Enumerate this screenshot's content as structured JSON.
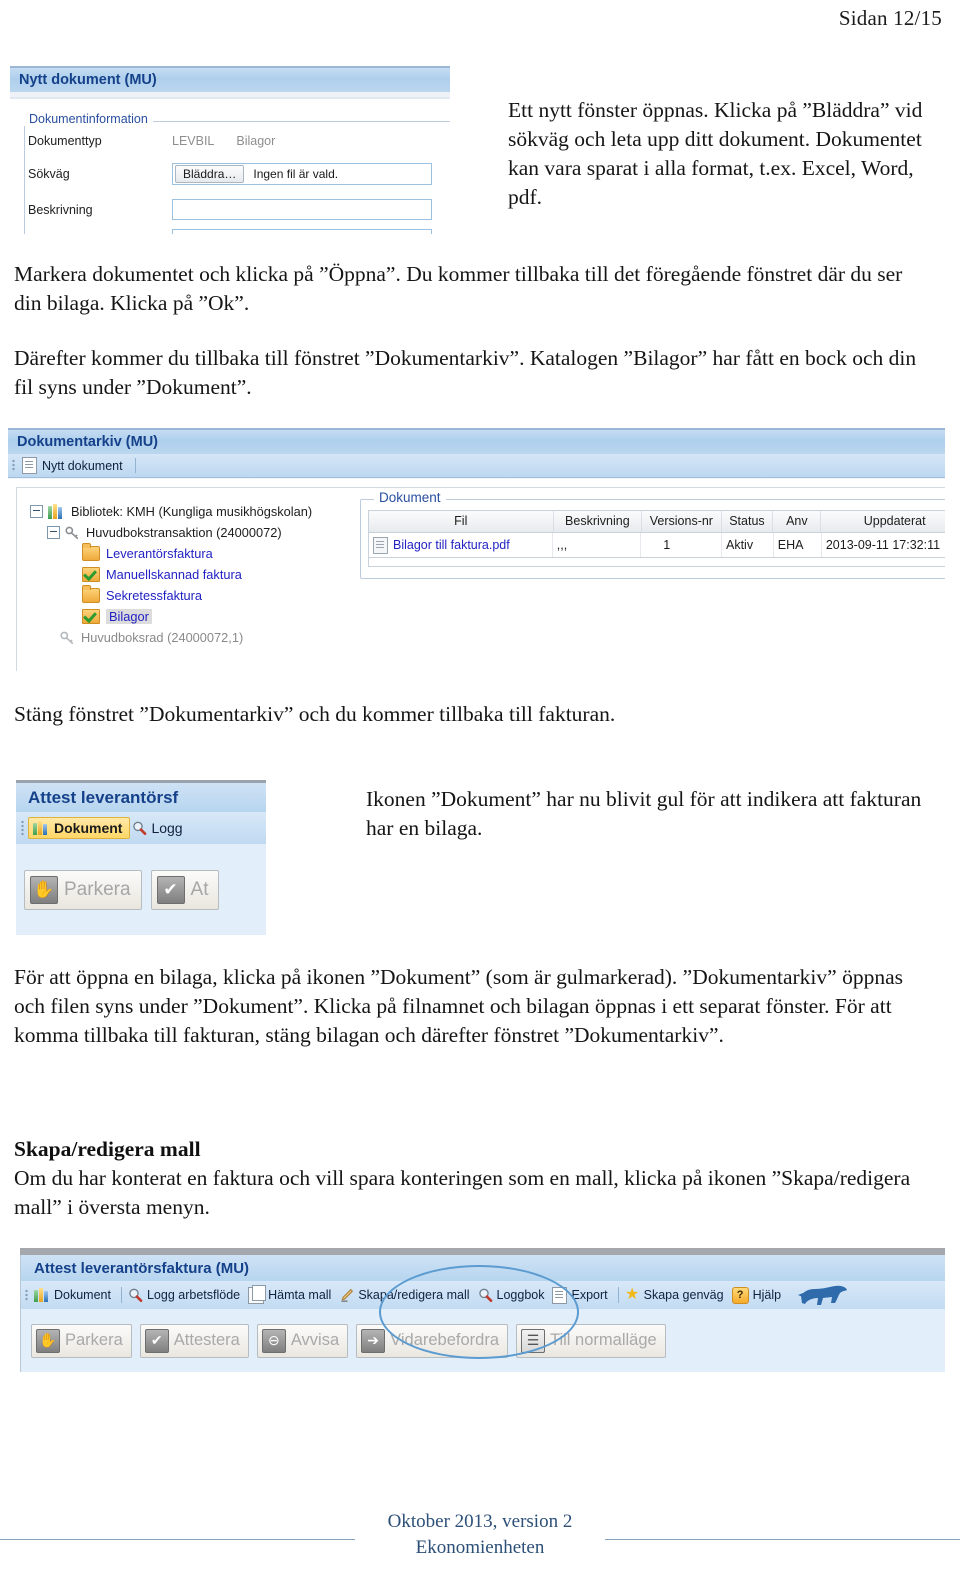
{
  "page": {
    "header": "Sidan 12/15"
  },
  "paragraphs": {
    "p_top_right": "Ett nytt fönster öppnas. Klicka på ”Bläddra” vid sökväg och leta upp ditt dokument. Dokumentet kan vara sparat i alla format, t.ex. Excel, Word, pdf.",
    "p_markera": "Markera dokumentet och klicka på ”Öppna”. Du kommer tillbaka till det föregående fönstret där du ser din bilaga. Klicka på ”Ok”.",
    "p_darefter": "Därefter kommer du tillbaka till fönstret ”Dokumentarkiv”. Katalogen ”Bilagor” har fått en bock och din fil syns under ”Dokument”.",
    "p_stang": "Stäng fönstret ”Dokumentarkiv” och du kommer tillbaka till fakturan.",
    "p_ikonen": "Ikonen ”Dokument” har nu blivit gul för att indikera att fakturan har en bilaga.",
    "p_foratt": "För att öppna en bilaga, klicka på ikonen ”Dokument” (som är gulmarkerad). ”Dokumentarkiv” öppnas och filen syns under ”Dokument”. Klicka på filnamnet och bilagan öppnas i ett separat fönster. För att komma tillbaka till fakturan, stäng bilagan och därefter fönstret ”Dokumentarkiv”.",
    "heading_skapa": "Skapa/redigera mall",
    "p_omdu": "Om du har konterat en faktura och vill spara konteringen som en mall, klicka på ikonen ”Skapa/redigera mall” i översta menyn."
  },
  "shot_nytt_dokument": {
    "title": "Nytt dokument (MU)",
    "group_legend": "Dokumentinformation",
    "rows": {
      "dokumenttyp_label": "Dokumenttyp",
      "dokumenttyp_value_1": "LEVBIL",
      "dokumenttyp_value_2": "Bilagor",
      "sokvag_label": "Sökväg",
      "browse_button": "Bläddra…",
      "browse_status": "Ingen fil är vald.",
      "beskrivning_label": "Beskrivning"
    }
  },
  "shot_dokumentarkiv": {
    "title": "Dokumentarkiv (MU)",
    "toolbar": {
      "new_document": "Nytt dokument"
    },
    "tree": [
      {
        "label": "Bibliotek: KMH (Kungliga musikhögskolan)",
        "icon": "books-icon",
        "style": "dark",
        "indent": 0,
        "expander": true
      },
      {
        "label": "Huvudbokstransaktion (24000072)",
        "icon": "key-icon",
        "style": "dark",
        "indent": 1,
        "expander": true
      },
      {
        "label": "Leverantörsfaktura",
        "icon": "folder-icon",
        "style": "link",
        "indent": 2,
        "expander": false
      },
      {
        "label": "Manuellskannad faktura",
        "icon": "folder-check-icon",
        "style": "link",
        "indent": 2,
        "expander": false
      },
      {
        "label": "Sekretessfaktura",
        "icon": "folder-icon",
        "style": "link",
        "indent": 2,
        "expander": false
      },
      {
        "label": "Bilagor",
        "icon": "folder-check-icon",
        "style": "selected",
        "indent": 2,
        "expander": false
      },
      {
        "label": "Huvudboksrad (24000072,1)",
        "icon": "key-icon",
        "style": "grey",
        "indent": 1,
        "expander": false
      }
    ],
    "document_group_legend": "Dokument",
    "grid": {
      "columns": [
        "Fil",
        "Beskrivning",
        "Versions-nr",
        "Status",
        "Anv",
        "Uppdaterat"
      ],
      "rows": [
        {
          "fil": "Bilagor till faktura.pdf",
          "beskrivning": ",,,",
          "versions_nr": "1",
          "status": "Aktiv",
          "anv": "EHA",
          "uppdaterat": "2013-09-11 17:32:11"
        }
      ]
    }
  },
  "shot_attest_crop": {
    "title": "Attest leverantörsf",
    "toolbar_items": [
      "Dokument",
      "Logg"
    ],
    "buttons": [
      "Parkera",
      "At"
    ]
  },
  "shot_bottom_toolbar": {
    "title": "Attest leverantörsfaktura (MU)",
    "toolbar_items": [
      {
        "label": "Dokument",
        "icon": "books-icon"
      },
      {
        "label": "Logg arbetsflöde",
        "icon": "magnifier-icon"
      },
      {
        "label": "Hämta mall",
        "icon": "copy-pages-icon"
      },
      {
        "label": "Skapa/redigera mall",
        "icon": "pencil-icon"
      },
      {
        "label": "Loggbok",
        "icon": "magnifier-icon"
      },
      {
        "label": "Export",
        "icon": "document-icon"
      },
      {
        "label": "Skapa genväg",
        "icon": "star-icon"
      },
      {
        "label": "Hjälp",
        "icon": "help-icon"
      }
    ],
    "action_buttons": [
      {
        "label": "Parkera",
        "icon": "hand-icon"
      },
      {
        "label": "Attestera",
        "icon": "check-icon"
      },
      {
        "label": "Avvisa",
        "icon": "minus-circle-icon"
      },
      {
        "label": "Vidarebefordra",
        "icon": "arrow-right-icon"
      },
      {
        "label": "Till normalläge",
        "icon": "rows-icon"
      }
    ],
    "highlight": "ellipse around Skapa/redigera mall",
    "highlight_color": "#5b9bd0"
  },
  "footer": {
    "line1": "Oktober 2013, version 2",
    "line2": "Ekonomienheten"
  }
}
